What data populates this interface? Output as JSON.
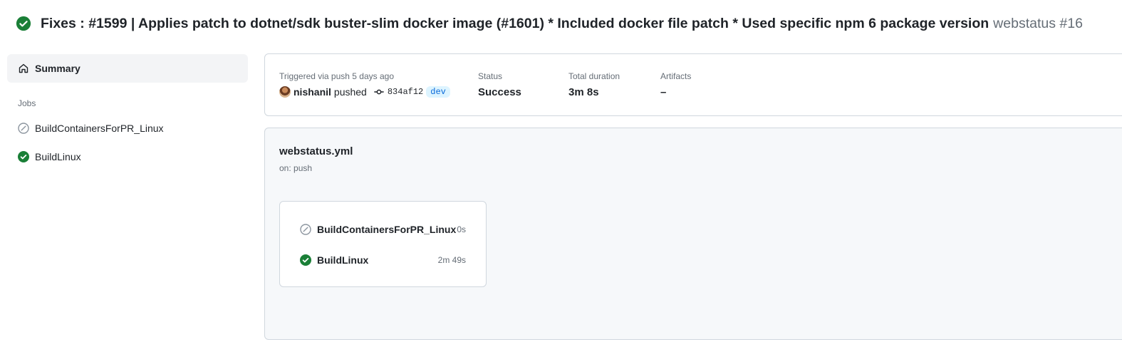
{
  "header": {
    "status": "success",
    "title": "Fixes : #1599 | Applies patch to dotnet/sdk buster-slim docker image (#1601) * Included docker file patch * Used specific npm 6 package version",
    "workflow_run": "webstatus #16"
  },
  "sidebar": {
    "summary_label": "Summary",
    "jobs_heading": "Jobs",
    "jobs": [
      {
        "label": "BuildContainersForPR_Linux",
        "status": "skipped",
        "icon": "skipped-icon"
      },
      {
        "label": "BuildLinux",
        "status": "success",
        "icon": "check-circle-icon"
      }
    ]
  },
  "run_info": {
    "trigger_label": "Triggered via push 5 days ago",
    "actor": "nishanil",
    "action": "pushed",
    "commit_sha": "834af12",
    "branch": "dev",
    "status_label": "Status",
    "status_value": "Success",
    "duration_label": "Total duration",
    "duration_value": "3m 8s",
    "artifacts_label": "Artifacts",
    "artifacts_value": "–"
  },
  "graph": {
    "workflow_file": "webstatus.yml",
    "on_event": "on: push",
    "jobs": [
      {
        "name": "BuildContainersForPR_Linux",
        "duration": "0s",
        "status": "skipped"
      },
      {
        "name": "BuildLinux",
        "duration": "2m 49s",
        "status": "success"
      }
    ]
  },
  "colors": {
    "success": "#1a7f37",
    "skipped": "#8c959f",
    "link": "#0969da"
  }
}
